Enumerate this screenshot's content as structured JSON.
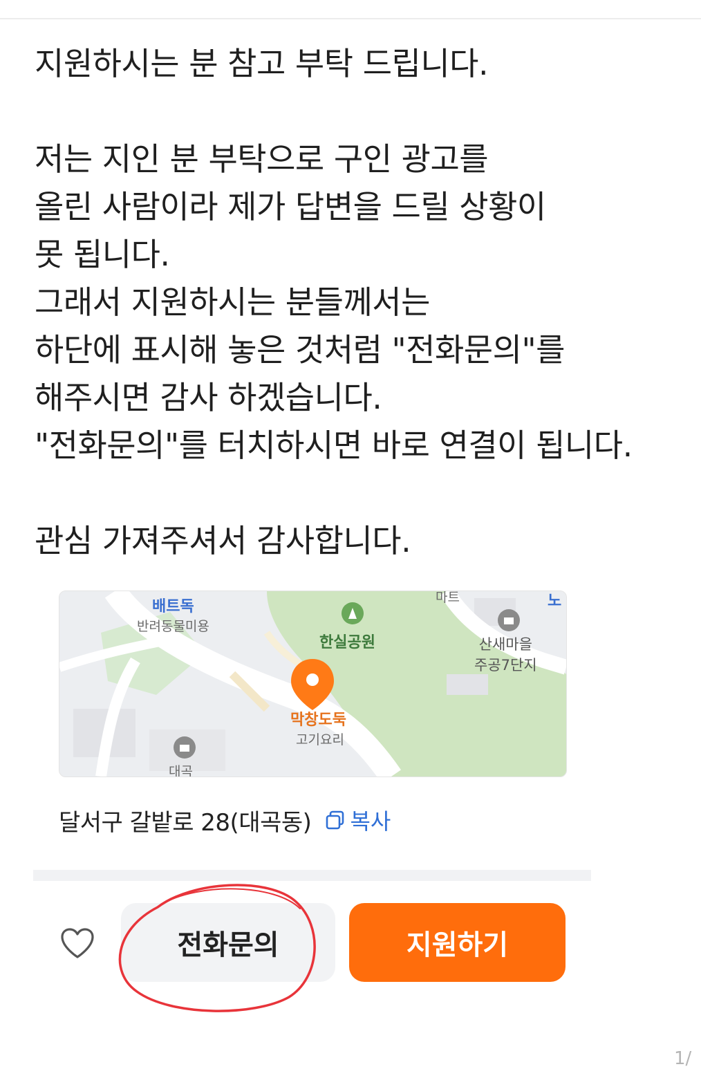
{
  "message": {
    "lines": [
      "지원하시는 분 참고 부탁 드립니다.",
      "",
      "저는 지인 분 부탁으로 구인 광고를",
      "올린 사람이라 제가 답변을 드릴 상황이",
      "못 됩니다.",
      "그래서 지원하시는 분들께서는",
      "하단에 표시해 놓은 것처럼 \"전화문의\"를",
      "해주시면 감사 하겠습니다.",
      "\"전화문의\"를 터치하시면 바로 연결이 됩니다.",
      "",
      "관심 가져주셔서 감사합니다."
    ]
  },
  "map": {
    "labels": {
      "petshop": "배트독",
      "petshop_sub": "반려동물미용",
      "park": "한실공원",
      "apartment_line1": "산새마을",
      "apartment_line2": "주공7단지",
      "restaurant": "막창도둑",
      "restaurant_sub": "고기요리",
      "mart": "마트",
      "daegok": "대곡",
      "top_right": "노"
    },
    "colors": {
      "park": "#cfe5c0",
      "road": "#ffffff",
      "block": "#e6e7ea",
      "pin": "#ff7a16"
    }
  },
  "address": {
    "text": "달서구 갈밭로 28(대곡동)",
    "copy_label": "복사"
  },
  "actions": {
    "call_label": "전화문의",
    "apply_label": "지원하기",
    "apply_color": "#ff6d0c"
  },
  "page_indicator": "1/"
}
